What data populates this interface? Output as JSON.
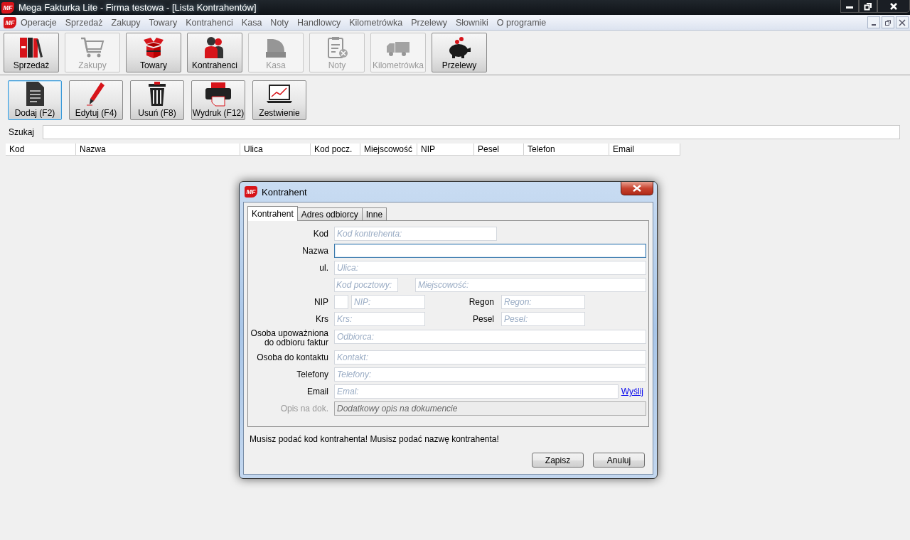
{
  "window": {
    "logo": "MF",
    "title": "Mega Fakturka Lite - Firma testowa - [Lista Kontrahentów]"
  },
  "menubar": {
    "logo": "MF",
    "items": [
      "Operacje",
      "Sprzedaż",
      "Zakupy",
      "Towary",
      "Kontrahenci",
      "Kasa",
      "Noty",
      "Handlowcy",
      "Kilometrówka",
      "Przelewy",
      "Słowniki",
      "O programie"
    ]
  },
  "modules": [
    {
      "label": "Sprzedaż",
      "disabled": false
    },
    {
      "label": "Zakupy",
      "disabled": true
    },
    {
      "label": "Towary",
      "disabled": false
    },
    {
      "label": "Kontrahenci",
      "disabled": false
    },
    {
      "label": "Kasa",
      "disabled": true
    },
    {
      "label": "Noty",
      "disabled": true
    },
    {
      "label": "Kilometrówka",
      "disabled": true
    },
    {
      "label": "Przelewy",
      "disabled": false
    }
  ],
  "actions": [
    {
      "label": "Dodaj (F2)",
      "focused": true
    },
    {
      "label": "Edytuj (F4)",
      "focused": false
    },
    {
      "label": "Usuń (F8)",
      "focused": false
    },
    {
      "label": "Wydruk (F12)",
      "focused": false
    },
    {
      "label": "Zestwienie",
      "focused": false
    }
  ],
  "search": {
    "label": "Szukaj"
  },
  "table": {
    "columns": [
      "Kod",
      "Nazwa",
      "Ulica",
      "Kod pocz.",
      "Miejscowość",
      "NIP",
      "Pesel",
      "Telefon",
      "Email"
    ]
  },
  "dialog": {
    "logo": "MF",
    "title": "Kontrahent",
    "tabs": [
      {
        "label": "Kontrahent",
        "selected": true
      },
      {
        "label": "Adres odbiorcy",
        "selected": false
      },
      {
        "label": "Inne",
        "selected": false
      }
    ],
    "rows": [
      {
        "label": "Kod",
        "fields": [
          {
            "kind": "short",
            "placeholder": "Kod kontrehenta:"
          }
        ]
      },
      {
        "label": "Nazwa",
        "fields": [
          {
            "kind": "full",
            "focused": true
          }
        ]
      },
      {
        "label": "ul.",
        "fields": [
          {
            "kind": "full",
            "placeholder": "Ulica:"
          }
        ]
      },
      {
        "fields": [
          {
            "kind": "postal",
            "placeholder": "Kod pocztowy:"
          },
          {
            "kind": "full",
            "placeholder": "Miejscowość:"
          }
        ]
      },
      {
        "label": "NIP",
        "fields": [
          {
            "kind": "tiny"
          },
          {
            "kind": "medium",
            "placeholder": "NIP:"
          }
        ],
        "side": {
          "label": "Regon",
          "placeholder": "Regon:"
        }
      },
      {
        "label": "Krs",
        "fields": [
          {
            "kind": "half",
            "placeholder": "Krs:"
          }
        ],
        "side": {
          "label": "Pesel",
          "placeholder": "Pesel:"
        }
      },
      {
        "label": "Osoba upoważniona do odbioru faktur",
        "fields": [
          {
            "kind": "full",
            "placeholder": "Odbiorca:"
          }
        ]
      },
      {
        "label": "Osoba do kontaktu",
        "fields": [
          {
            "kind": "full",
            "placeholder": "Kontakt:"
          }
        ]
      },
      {
        "label": "Telefony",
        "fields": [
          {
            "kind": "full",
            "placeholder": "Telefony:"
          }
        ]
      },
      {
        "label": "Email",
        "fields": [
          {
            "kind": "full",
            "placeholder": "Emal:"
          }
        ],
        "link": "Wyślij"
      },
      {
        "label": "Opis na dok.",
        "disabled": true,
        "fields": [
          {
            "kind": "full",
            "placeholder": "Dodatkowy opis na dokumencie"
          }
        ]
      }
    ],
    "message": "Musisz podać kod kontrahenta! Musisz podać nazwę kontrahenta!",
    "buttons": [
      "Zapisz",
      "Anuluj"
    ]
  }
}
